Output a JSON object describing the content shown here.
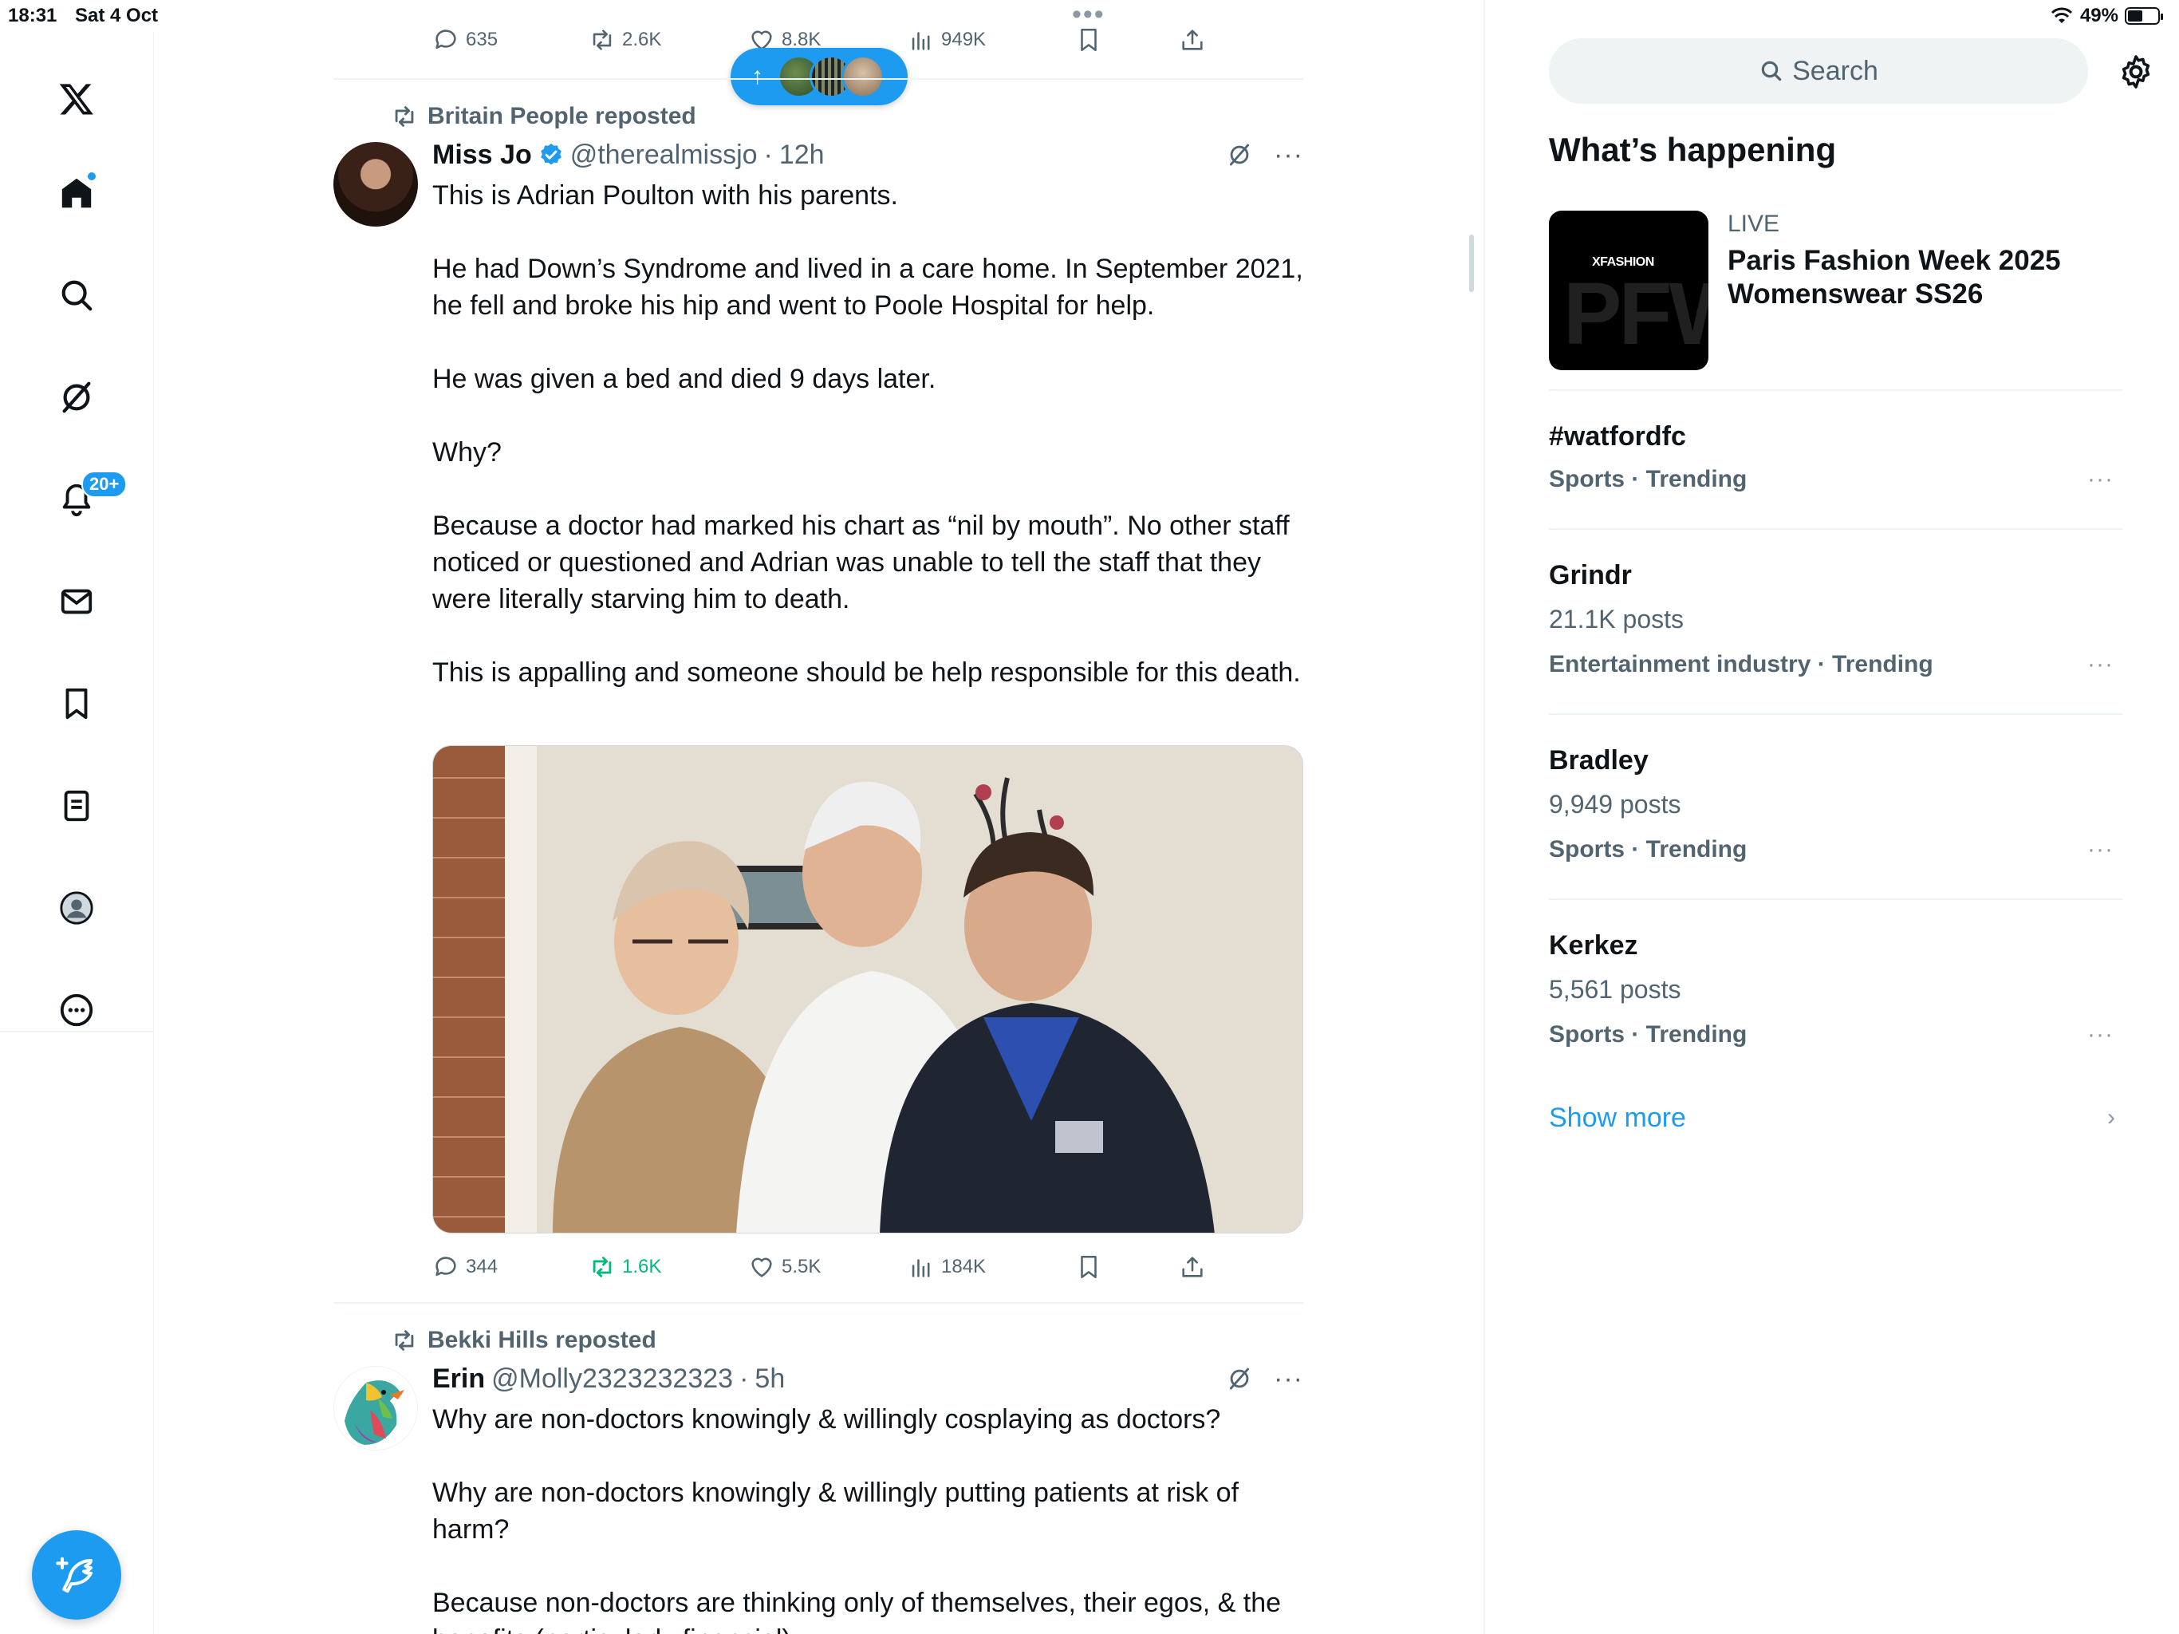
{
  "status_bar": {
    "time": "18:31",
    "date": "Sat 4 Oct",
    "battery": "49%",
    "battery_level": 0.49
  },
  "nav": {
    "items": [
      "home",
      "explore",
      "grok",
      "notifications",
      "messages",
      "bookmarks",
      "lists",
      "profile",
      "more"
    ],
    "notifications_badge": "20+"
  },
  "feed": {
    "top_actions": {
      "replies": "635",
      "reposts": "2.6K",
      "likes": "8.8K",
      "views": "949K"
    },
    "new_posts_arrow": "↑",
    "tweets": [
      {
        "repost_by": "Britain People reposted",
        "name": "Miss Jo",
        "handle": "@therealmissjo",
        "sep": "·",
        "time": "12h",
        "paragraphs": [
          "This is Adrian Poulton with his parents.",
          "He had Down’s Syndrome and lived in a care home. In September 2021, he fell and broke his hip and went to Poole Hospital for help.",
          "He was given a bed and died 9 days later.",
          "Why?",
          "Because a doctor had marked his chart as “nil by mouth”. No other staff noticed or questioned and Adrian was unable to tell the staff that they were literally starving him to death.",
          "This is appalling and someone should be help responsible for this death."
        ],
        "actions": {
          "replies": "344",
          "reposts": "1.6K",
          "likes": "5.5K",
          "views": "184K"
        }
      },
      {
        "repost_by": "Bekki Hills reposted",
        "name": "Erin",
        "handle": "@Molly2323232323",
        "sep": "·",
        "time": "5h",
        "paragraphs": [
          "Why are non-doctors knowingly & willingly cosplaying as doctors?",
          "Why are non-doctors knowingly & willingly putting patients at risk of harm?",
          "Because non-doctors are thinking only of themselves, their egos, & the benefits (particularly financial)."
        ]
      }
    ]
  },
  "right": {
    "search_placeholder": "Search",
    "section_title": "What’s happening",
    "live": {
      "label": "LIVE",
      "title": "Paris Fashion Week 2025 Womenswear SS26",
      "thumb_logo": "XFASHION",
      "thumb_big": "PFW"
    },
    "trends": [
      {
        "name": "#watfordfc",
        "count": "",
        "meta": "Sports · Trending"
      },
      {
        "name": "Grindr",
        "count": "21.1K posts",
        "meta": "Entertainment industry · Trending"
      },
      {
        "name": "Bradley",
        "count": "9,949 posts",
        "meta": "Sports · Trending"
      },
      {
        "name": "Kerkez",
        "count": "5,561 posts",
        "meta": "Sports · Trending"
      }
    ],
    "show_more": "Show more",
    "more_glyph": "···",
    "chevron": "›"
  },
  "colors": {
    "accent": "#1d9bf0",
    "retweet_green": "#00ba7c",
    "secondary_text": "#536471"
  }
}
